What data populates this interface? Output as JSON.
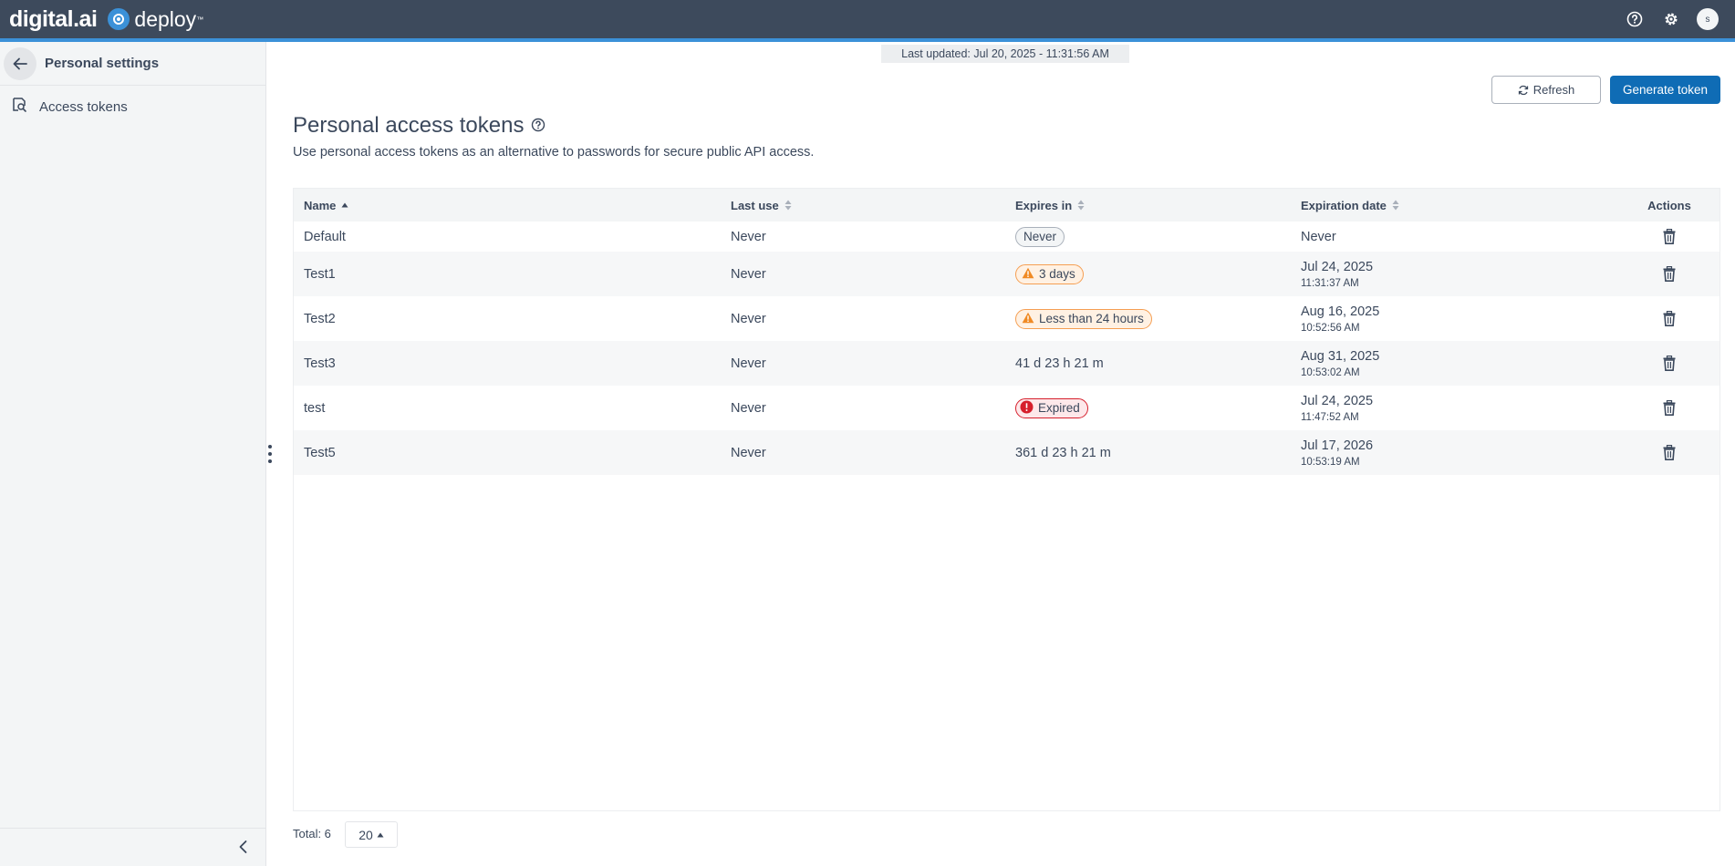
{
  "header": {
    "brand": "digital.ai",
    "product": "deploy",
    "trademark": "™",
    "avatar_initial": "s",
    "icons": [
      "help-icon",
      "gear-icon",
      "user-avatar"
    ]
  },
  "sidebar": {
    "title": "Personal settings",
    "items": [
      {
        "label": "Access tokens",
        "icon": "token-search-icon"
      }
    ]
  },
  "main": {
    "last_updated": "Last updated: Jul 20, 2025 - 11:31:56 AM",
    "refresh_label": "Refresh",
    "generate_label": "Generate token",
    "title": "Personal access tokens",
    "description": "Use personal access tokens as an alternative to passwords for secure public API access.",
    "table": {
      "headers": [
        "Name",
        "Last use",
        "Expires in",
        "Expiration date",
        "Actions"
      ],
      "rows": [
        {
          "name": "Default",
          "last_use": "Never",
          "expires_in": "Never",
          "expires_style": "gray",
          "exp_date": "Never",
          "exp_time": ""
        },
        {
          "name": "Test1",
          "last_use": "Never",
          "expires_in": "3 days",
          "expires_style": "warn",
          "exp_date": "Jul 24, 2025",
          "exp_time": "11:31:37 AM"
        },
        {
          "name": "Test2",
          "last_use": "Never",
          "expires_in": "Less than 24 hours",
          "expires_style": "warn",
          "exp_date": "Aug 16, 2025",
          "exp_time": "10:52:56 AM"
        },
        {
          "name": "Test3",
          "last_use": "Never",
          "expires_in": "41 d 23 h 21 m",
          "expires_style": "plain",
          "exp_date": "Aug 31, 2025",
          "exp_time": "10:53:02 AM"
        },
        {
          "name": "test",
          "last_use": "Never",
          "expires_in": "Expired",
          "expires_style": "error",
          "exp_date": "Jul 24, 2025",
          "exp_time": "11:47:52 AM"
        },
        {
          "name": "Test5",
          "last_use": "Never",
          "expires_in": "361 d 23 h 21 m",
          "expires_style": "plain",
          "exp_date": "Jul 17, 2026",
          "exp_time": "10:53:19 AM"
        }
      ]
    },
    "total_label": "Total: 6",
    "page_size": "20"
  },
  "colors": {
    "topbar": "#3d4a5c",
    "accent": "#3b91d8",
    "primary_button": "#0f6cb5",
    "warning": "#f59e52",
    "error": "#d61f2c"
  }
}
